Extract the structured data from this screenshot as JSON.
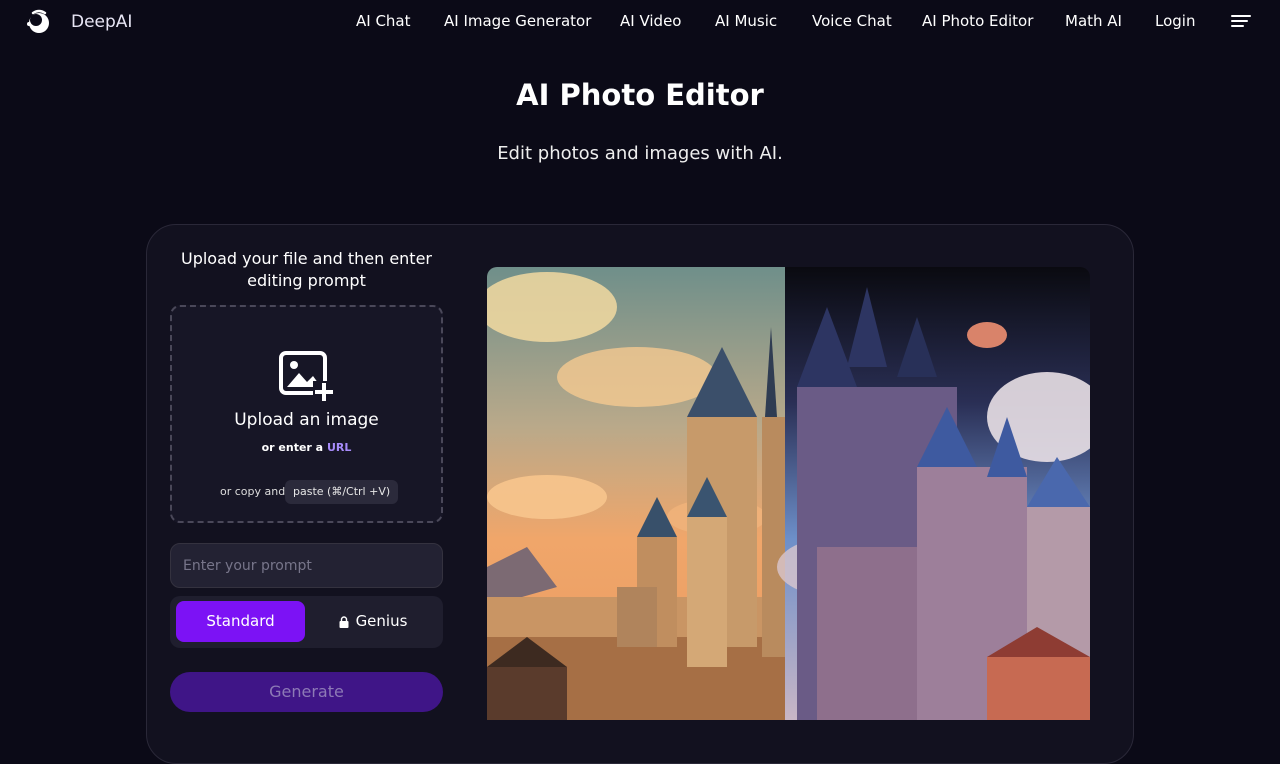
{
  "brand": {
    "name": "DeepAI"
  },
  "nav": {
    "links": [
      {
        "label": "AI Chat"
      },
      {
        "label": "AI Image Generator"
      },
      {
        "label": "AI Video"
      },
      {
        "label": "AI Music"
      },
      {
        "label": "Voice Chat"
      },
      {
        "label": "AI Photo Editor"
      },
      {
        "label": "Math AI"
      },
      {
        "label": "Login"
      }
    ]
  },
  "hero": {
    "title": "AI Photo Editor",
    "subtitle": "Edit photos and images with AI."
  },
  "panel": {
    "heading": "Upload your file and then enter editing prompt",
    "upload_label": "Upload an image",
    "url_prefix": "or enter a",
    "url_link": "URL",
    "copy_prefix": "or copy and",
    "paste_label": "paste (⌘/Ctrl +V)",
    "prompt_placeholder": "Enter your prompt",
    "mode_standard": "Standard",
    "mode_genius": "Genius",
    "generate_label": "Generate"
  },
  "colors": {
    "background": "#0b0a17",
    "accent": "#7c12f5",
    "link": "#a78bfa",
    "generate_bg": "#3f1587"
  },
  "icons": {
    "brand": "deepai-logo-icon",
    "menu": "hamburger-menu-icon",
    "upload": "image-add-icon",
    "lock": "lock-icon"
  }
}
